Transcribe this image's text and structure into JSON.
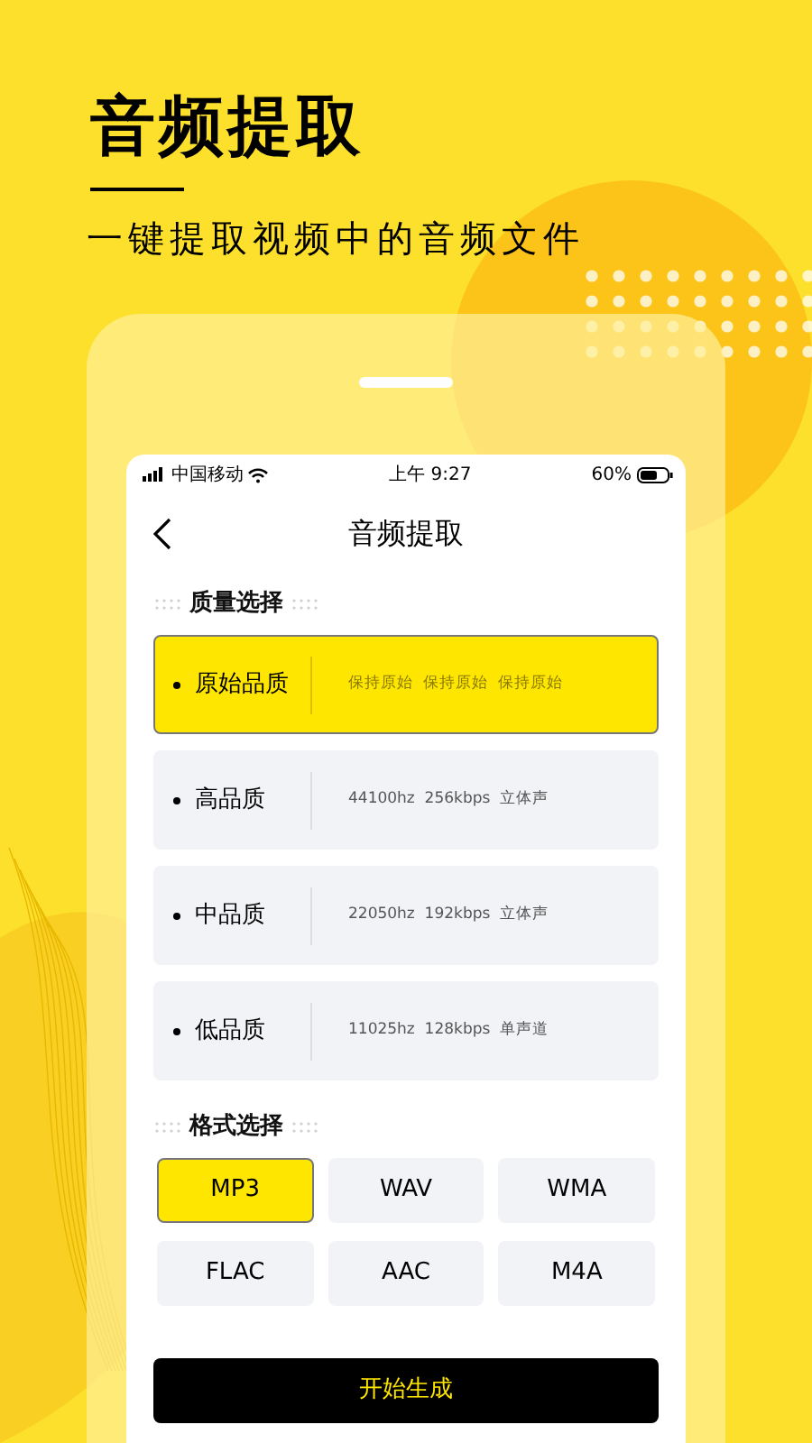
{
  "headline": "音频提取",
  "subtitle": "一键提取视频中的音频文件",
  "status_bar": {
    "carrier": "中国移动",
    "time": "上午 9:27",
    "battery": "60%"
  },
  "nav": {
    "title": "音频提取"
  },
  "quality": {
    "label": "质量选择",
    "items": [
      {
        "name": "原始品质",
        "details": "保持原始  保持原始  保持原始",
        "selected": true
      },
      {
        "name": "高品质",
        "details": "44100hz  256kbps  立体声",
        "selected": false
      },
      {
        "name": "中品质",
        "details": "22050hz  192kbps  立体声",
        "selected": false
      },
      {
        "name": "低品质",
        "details": "11025hz  128kbps  单声道",
        "selected": false
      }
    ]
  },
  "format": {
    "label": "格式选择",
    "items": [
      {
        "name": "MP3",
        "selected": true
      },
      {
        "name": "WAV",
        "selected": false
      },
      {
        "name": "WMA",
        "selected": false
      },
      {
        "name": "FLAC",
        "selected": false
      },
      {
        "name": "AAC",
        "selected": false
      },
      {
        "name": "M4A",
        "selected": false
      }
    ]
  },
  "action_button": "开始生成"
}
